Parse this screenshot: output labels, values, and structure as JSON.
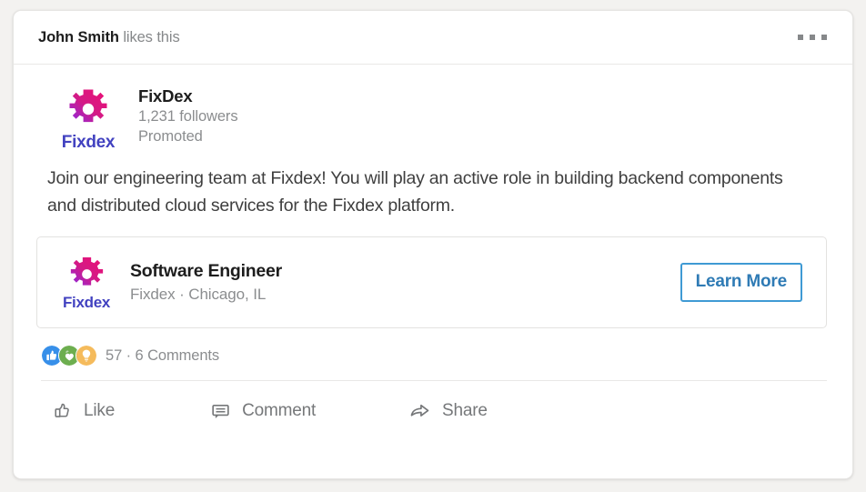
{
  "header": {
    "actor_name": "John Smith",
    "social_proof_suffix": " likes this",
    "overflow_menu_label": "More options"
  },
  "author": {
    "logo_wordmark": "Fixdex",
    "company_name": "FixDex",
    "followers": "1,231 followers",
    "promoted_label": "Promoted"
  },
  "post": {
    "body": "Join our engineering team at Fixdex! You will play an active role in building backend components and distributed cloud services for the Fixdex platform."
  },
  "entity": {
    "logo_wordmark": "Fixdex",
    "title": "Software Engineer",
    "subtitle": "Fixdex · Chicago, IL",
    "cta_label": "Learn More"
  },
  "social": {
    "reactions": [
      {
        "name": "like-reaction",
        "color": "#378fe9"
      },
      {
        "name": "support-reaction",
        "color": "#6dae4f"
      },
      {
        "name": "insightful-reaction",
        "color": "#f5bb5c"
      }
    ],
    "counts_text": "57 · 6 Comments"
  },
  "actions": {
    "like_label": "Like",
    "comment_label": "Comment",
    "share_label": "Share"
  },
  "colors": {
    "brand_gear_start": "#8a2be2",
    "brand_gear_end": "#e5127d",
    "wordmark": "#4242c0",
    "cta_border": "#3f9ad4",
    "cta_text": "#2f7bb5",
    "card_background": "#ffffff",
    "page_background": "#f3f2f0"
  }
}
